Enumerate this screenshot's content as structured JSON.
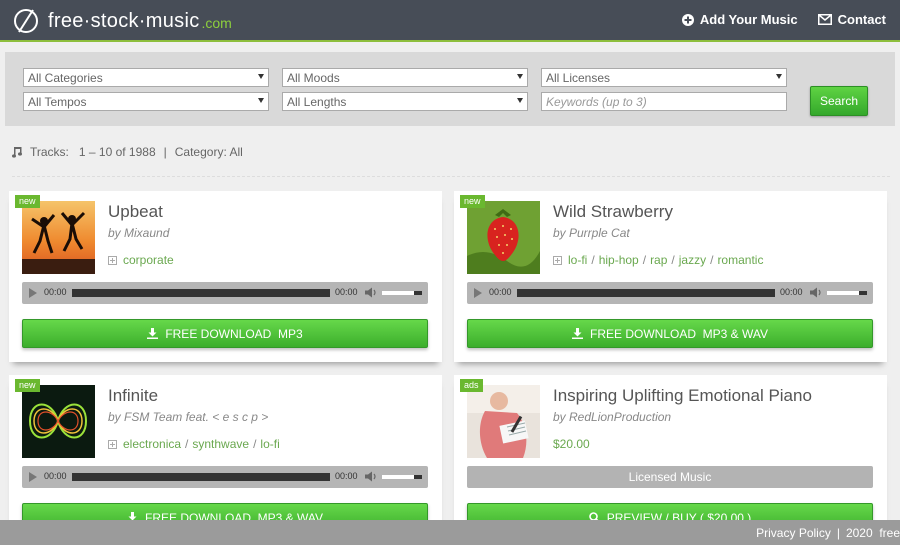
{
  "header": {
    "logo": {
      "main": "free·stock·music",
      "tld": ".com"
    },
    "nav": {
      "add_music": "Add Your Music",
      "contact": "Contact"
    }
  },
  "filters": {
    "categories": "All Categories",
    "moods": "All Moods",
    "licenses": "All Licenses",
    "tempos": "All Tempos",
    "lengths": "All Lengths",
    "keywords_placeholder": "Keywords (up to 3)",
    "search_label": "Search"
  },
  "info": {
    "tracks_label": "Tracks:",
    "tracks_range": "1 – 10 of 1988",
    "separator": "|",
    "category": "Category: All"
  },
  "tracks": [
    {
      "badge": "new",
      "title": "Upbeat",
      "author": "by Mixaund",
      "tags": [
        "corporate"
      ],
      "time_start": "00:00",
      "time_end": "00:00",
      "download_label": "FREE DOWNLOAD  MP3"
    },
    {
      "badge": "new",
      "title": "Wild Strawberry",
      "author": "by Purrple Cat",
      "tags": [
        "lo-fi",
        "hip-hop",
        "rap",
        "jazzy",
        "romantic"
      ],
      "time_start": "00:00",
      "time_end": "00:00",
      "download_label": "FREE DOWNLOAD  MP3 & WAV"
    },
    {
      "badge": "new",
      "title": "Infinite",
      "author": "by FSM Team feat. < e s c p >",
      "tags": [
        "electronica",
        "synthwave",
        "lo-fi"
      ],
      "time_start": "00:00",
      "time_end": "00:00",
      "download_label": "FREE DOWNLOAD  MP3 & WAV"
    },
    {
      "badge": "ads",
      "title": "Inspiring Uplifting Emotional Piano",
      "author": "by RedLionProduction",
      "price": "$20.00",
      "licensed_label": "Licensed Music",
      "download_label": "PREVIEW / BUY ( $20.00 )"
    }
  ],
  "footer": {
    "privacy": "Privacy Policy",
    "separator": "|",
    "copyright": "2020  free"
  },
  "colors": {
    "header_bg": "#474d57",
    "accent_green": "#6ab82f",
    "button_green": "#4cc036",
    "footer_bg": "#9b9b9b"
  },
  "icons": {
    "logo": "disc-slash-icon",
    "add": "plus-circle-icon",
    "contact": "envelope-icon",
    "tracks": "music-note-icon",
    "download": "download-icon",
    "preview": "magnifier-icon"
  }
}
